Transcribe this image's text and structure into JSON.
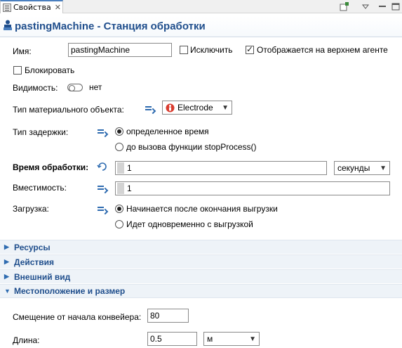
{
  "tab": {
    "label": "Свойства",
    "close": "✕"
  },
  "title": "pastingMachine - Станция обработки",
  "name": {
    "label": "Имя:",
    "value": "pastingMachine"
  },
  "exclude": {
    "label": "Исключить"
  },
  "top_agent": {
    "label": "Отображается на верхнем агенте"
  },
  "block": {
    "label": "Блокировать"
  },
  "visibility": {
    "label": "Видимость:",
    "value": "нет"
  },
  "material_type": {
    "label": "Тип материального объекта:",
    "value": "Electrode"
  },
  "delay_type": {
    "label": "Тип задержки:",
    "options": [
      "определенное время",
      "до вызова функции stopProcess()"
    ]
  },
  "process_time": {
    "label": "Время обработки:",
    "value": "1",
    "unit": "секунды"
  },
  "capacity": {
    "label": "Вместимость:",
    "value": "1"
  },
  "loading": {
    "label": "Загрузка:",
    "options": [
      "Начинается после окончания выгрузки",
      "Идет одновременно с выгрузкой"
    ]
  },
  "sections": [
    "Ресурсы",
    "Действия",
    "Внешний вид",
    "Местоположение и размер"
  ],
  "offset": {
    "label": "Смещение от начала конвейера:",
    "value": "80"
  },
  "length": {
    "label": "Длина:",
    "value": "0.5",
    "unit": "м"
  }
}
